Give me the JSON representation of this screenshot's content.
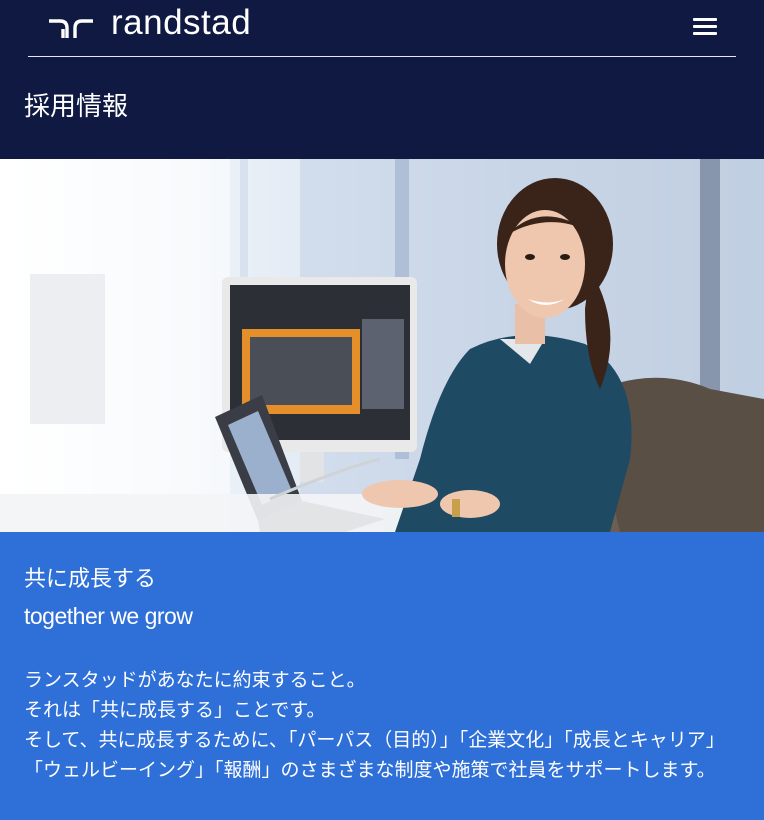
{
  "header": {
    "brand_name": "randstad",
    "menu_icon": "hamburger-icon",
    "page_title": "採用情報",
    "background_color": "#0f1941"
  },
  "hero": {
    "image": "woman-smiling-at-desk-with-monitor-and-laptop"
  },
  "content": {
    "background_color": "#2f6fd8",
    "tagline_ja": "共に成長する",
    "tagline_en": "together we grow",
    "paragraphs": [
      "ランスタッドがあなたに約束すること。",
      "それは「共に成長する」ことです。",
      "そして、共に成長するために、「パーパス（目的）」「企業文化」「成長とキャリア」「ウェルビーイング」「報酬」のさまざまな制度や施策で社員をサポートします。"
    ]
  }
}
